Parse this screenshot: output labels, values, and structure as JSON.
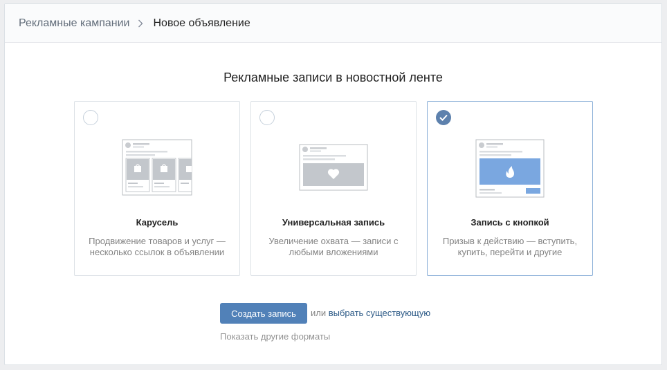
{
  "breadcrumb": {
    "parent": "Рекламные кампании",
    "current": "Новое объявление"
  },
  "section_title": "Рекламные записи в новостной ленте",
  "cards": [
    {
      "title": "Карусель",
      "description": "Продвижение товаров и услуг — несколько ссылок в объявлении",
      "selected": false,
      "icon": "carousel-illustration"
    },
    {
      "title": "Универсальная запись",
      "description": "Увеличение охвата — записи с любыми вложениями",
      "selected": false,
      "icon": "universal-post-illustration"
    },
    {
      "title": "Запись с кнопкой",
      "description": "Призыв к действию — вступить, купить, перейти и другие",
      "selected": true,
      "icon": "button-post-illustration"
    }
  ],
  "actions": {
    "create_label": "Создать запись",
    "or_text": "или",
    "choose_existing": "выбрать существующую",
    "other_formats": "Показать другие форматы"
  },
  "colors": {
    "accent": "#5181b8",
    "selected_border": "#8cb0d8",
    "check_bg": "#5d81ad",
    "link": "#2a5885",
    "illus_blue": "#7aa7e0"
  }
}
